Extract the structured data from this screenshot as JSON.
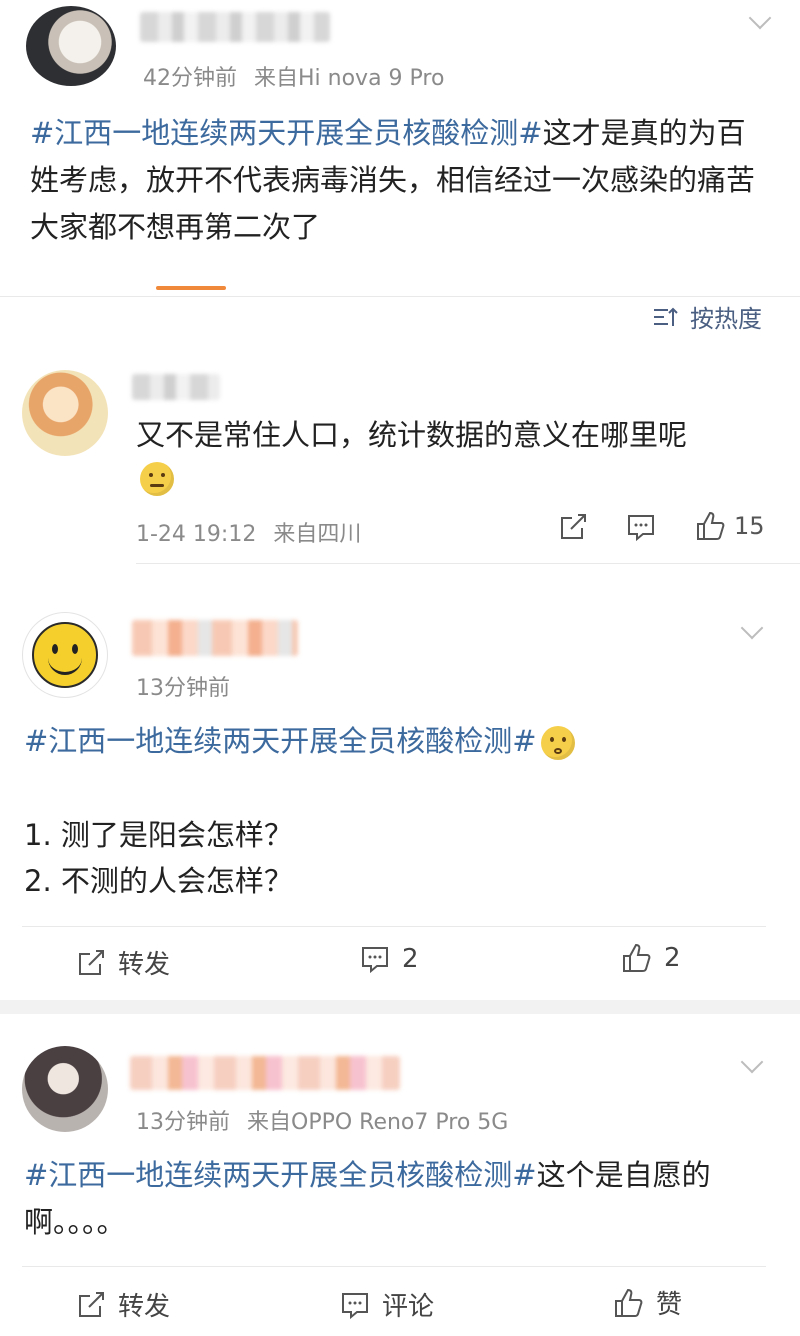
{
  "post": {
    "time": "42分钟前",
    "source": "来自Hi nova 9 Pro",
    "topic": "#江西一地连续两天开展全员核酸检测#",
    "text": "这才是真的为百姓考虑，放开不代表病毒消失，相信经过一次感染的痛苦大家都不想再第二次了"
  },
  "sort": {
    "label": "按热度",
    "icon": "sort-icon"
  },
  "comment": {
    "text": "又不是常住人口，统计数据的意义在哪里呢",
    "emoji": "thinking-emoji",
    "time": "1-24 19:12",
    "source": "来自四川",
    "like_count": "15"
  },
  "post2": {
    "time": "13分钟前",
    "topic": "#江西一地连续两天开展全员核酸检测#",
    "emoji": "confused-emoji",
    "line1": "1. 测了是阳会怎样？",
    "line2": "2. 不测的人会怎样？",
    "repost_label": "转发",
    "comment_count": "2",
    "like_count": "2"
  },
  "post3": {
    "time": "13分钟前",
    "source": "来自OPPO Reno7 Pro 5G",
    "topic": "#江西一地连续两天开展全员核酸检测#",
    "text": "这个是自愿的啊。。。。",
    "repost_label": "转发",
    "comment_label": "评论",
    "like_label": "赞"
  },
  "colors": {
    "topic": "#3d6a9e",
    "accent_underline": "#f08a3a",
    "meta": "#8a8a8a"
  }
}
